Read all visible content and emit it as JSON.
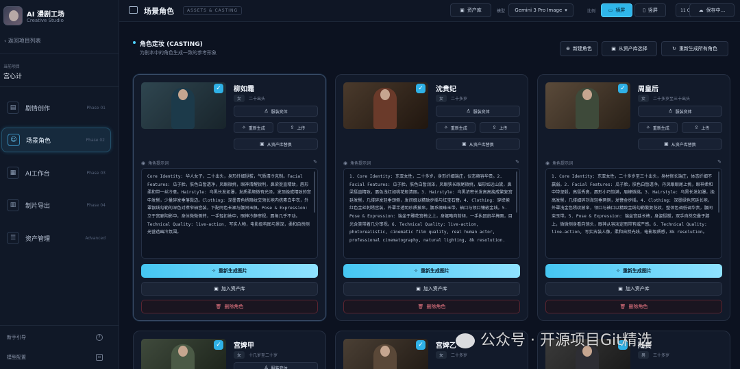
{
  "app": {
    "title": "AI 漫剧工场",
    "subtitle": "Creative Studio"
  },
  "sidebar": {
    "back": "返回项目列表",
    "project_label": "当前项目",
    "project_name": "宫心计",
    "items": [
      {
        "label": "剧情创作",
        "phase": "Phase 01"
      },
      {
        "label": "场景角色",
        "phase": "Phase 02"
      },
      {
        "label": "AI工作台",
        "phase": "Phase 03"
      },
      {
        "label": "制片导出",
        "phase": "Phase 04"
      },
      {
        "label": "资产管理",
        "phase": "Advanced"
      }
    ],
    "footer": [
      {
        "label": "新手引导"
      },
      {
        "label": "模型配置"
      }
    ]
  },
  "topbar": {
    "title": "场景角色",
    "tag": "ASSETS & CASTING",
    "asset_btn": "资产库",
    "model_label": "模型",
    "model_value": "Gemini 3 Pro Image",
    "ratio_label": "比例",
    "landscape": "横屏",
    "portrait": "竖屏",
    "counter": "11 C",
    "save": "保存中..."
  },
  "section": {
    "title": "角色定妆 (CASTING)",
    "subtitle": "为剧本中的角色生成一致的参考形象",
    "new_char": "新建角色",
    "from_lib": "从资产库选择",
    "regen_all": "重新生成所有角色"
  },
  "card_labels": {
    "costume": "服装变体",
    "regen": "重新生成",
    "upload": "上传",
    "replace": "从资产库替换",
    "prompt": "角色提示词",
    "regen_image": "重新生成图片",
    "add_lib": "加入资产库",
    "delete": "删除角色"
  },
  "characters": [
    {
      "name": "柳如霜",
      "gender": "女",
      "age": "二十出头",
      "prompt": "Core Identity: 华人女子，二十出头，身形纤细挺拔，气质清冷克制。Facial Features: 瓜子脸，肤色白皙透净，凤眼微挑，眼神清醒锐利，鼻梁挺直精致，唇形柔和带一丝冷意。Hairstyle: 乌黑长发如瀑，发质柔顺微有光泽，发顶挽成精致的宫中发髻，少量碎发垂落鬓边。Clothing: 深墨青色绣暗纹交领长袍内搭素白中衣，外罩银线勾勒的深色对襟窄袖宫装，下配同色长裙与腰间玉佩。Pose & Expression: 立于宫廊阴影中，身体微微侧转，一手轻扣袖中，眼神冷静审视，唇角几乎不动。Technical Quality: live-action, 写实人物，电影级构图与景深，柔和自然侧光营造幽冷氛围。"
    },
    {
      "name": "沈贵妃",
      "gender": "女",
      "age": "二十多岁",
      "prompt": "1. Core Identity: 东亚女性，二十多岁，身形纤细端庄，仪态雍容华贵。2. Facial Features: 瓜子脸，肤色白皙润泽，凤眼狭长眼尾微挑，眉形如远山黛，鼻梁挺直精致，唇色浅红如桃花般清丽。3. Hairstyle: 乌黑浓密长发高高挽成繁复宫廷发髻，几缕碎发轻垂颈侧，发间缀以精致步摇与红宝石簪。4. Clothing: 穿绛紫红色金丝刺绣宫装，外罩半透明纱质披帛，腰系缀珠玉带，袖口与领口镶嵌金线。5. Pose & Expression: 端坐于雕花宫椅之上，身躯略向前倾，一手执团扇半掩面，目光含笑带着几分审视。6. Technical Quality: live-action, photorealistic, cinematic film quality, real human actor, professional cinematography, natural lighting, 8k resolution."
    },
    {
      "name": "周皇后",
      "gender": "女",
      "age": "二十多岁至三十出头",
      "prompt": "1. Core Identity: 东亚女性，二十多岁至三十出头，身材修长端庄，体态纤细不羸弱。2. Facial Features: 瓜子脸，肤色白皙透净，丹凤眼眼尾上挑，眼神柔和中带坚毅，高挺秀鼻，唇形小巧饱满，眉峰微挑。3. Hairstyle: 乌黑长发如瀑，挽高发髻，几缕细碎刘海轻垂两侧，发簪金步摇。4. Clothing: 深墨绿色宫廷长袍，外罩浅金色绣纹披帛，领口与袖口以精致金线勾勒繁复花纹，整体色调低调华贵，腰间束玉带。5. Pose & Expression: 端坐宫廷长椅，身姿挺拔，双手自然交叠于膝上，微微侧身看向镜头，眼神从容淡定而带有威严感。6. Technical Quality: live-action, 写实古装人像，柔和自然光线，电影级质感，8k resolution。"
    }
  ],
  "characters_row2": [
    {
      "name": "宫婢甲",
      "gender": "女",
      "age": "十几岁至二十岁"
    },
    {
      "name": "宫婢乙",
      "gender": "女",
      "age": "二十多岁"
    },
    {
      "name": "陆贵",
      "gender": "男",
      "age": "三十多岁"
    }
  ],
  "watermark": "公众号 · 开源项目Git精选"
}
